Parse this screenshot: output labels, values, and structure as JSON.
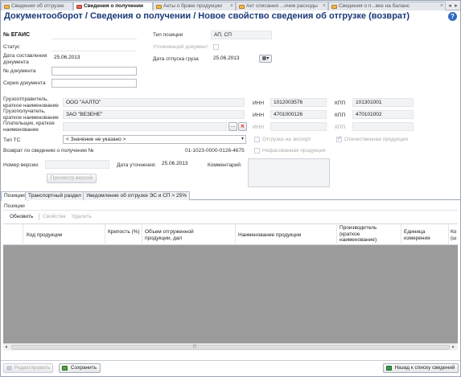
{
  "tabs": [
    {
      "label": "Сведения об отгрузке",
      "active": false
    },
    {
      "label": "Сведения о получении",
      "active": true
    },
    {
      "label": "Акты о браке продукции",
      "active": false
    },
    {
      "label": "Акт списания ...очие расходы",
      "active": false
    },
    {
      "label": "Сведения о п...вке на баланс",
      "active": false
    }
  ],
  "tab_close": "×",
  "title": "Документооборот  / Сведения о получении / Новое свойство сведения об отгрузке (возврат)",
  "help": "?",
  "form": {
    "egais_label": "№ ЕГАИС",
    "status_label": "Статус",
    "doc_date_label": "Дата составления документа",
    "doc_date_value": "25.06.2013",
    "doc_number_label": "№ документа",
    "doc_series_label": "Серия  документа",
    "position_type_label": "Тип позиции",
    "position_type_value": "АП, СП",
    "clarifying_doc_label": "Уточняющий документ",
    "ship_date_label": "Дата отпуска груза",
    "ship_date_value": "25.06.2013",
    "shipper_label": "Грузоотправитель, краткое наименование",
    "shipper_value": "ООО \"ААЛТО\"",
    "consignee_label": "Грузополучатель, краткое наименование",
    "consignee_value": "ЗАО \"ВЕЗЕНЕ\"",
    "payer_label": "Плательщик, краткое наименование",
    "inn_label": "ИНН",
    "kpp_label": "КПП",
    "shipper_inn": "1012003576",
    "shipper_kpp": "101301001",
    "consignee_inn": "4701000126",
    "consignee_kpp": "470101002",
    "payer_pick": "...",
    "payer_clear": "✕",
    "vehicle_type_label": "Тип ТС",
    "vehicle_type_value": "< Значение не указано >",
    "export_label": "Отгрузка на экспорт",
    "domestic_label": "Отечественная продукция",
    "unpacked_label": "Нефасованная продукция",
    "return_label": "Возврат по сведению о получении №",
    "return_value": "01-1023-0000-0126-4675",
    "version_label": "Номер версии:",
    "clarify_date_label": "Дата уточнения:",
    "clarify_date_value": "25.06.2013",
    "comment_label": "Комментарий:",
    "view_versions_button": "Просмотр версий"
  },
  "section_tabs": [
    "Позиции",
    "Транспортный раздел",
    "Уведомление об отгрузке ЭС и СП > 25%"
  ],
  "positions": {
    "group_label": "Позиции",
    "toolbar": {
      "refresh": "Обновить",
      "properties": "Свойства",
      "delete": "Удалить"
    },
    "columns": [
      "Код продукции",
      "Крепость (%)",
      "Объем отгруженной продукции, дал",
      "Наименование продукции",
      "Производитель (краткое наименование)",
      "Единица измерения",
      "Ко (ш"
    ]
  },
  "footer": {
    "edit_button": "Редактировать",
    "save_button": "Сохранить",
    "back_button": "Назад к списку сведений"
  },
  "colors": {
    "title": "#1a3978",
    "grid_empty": "#9b9b9b",
    "accent": "#2f6ac1"
  }
}
